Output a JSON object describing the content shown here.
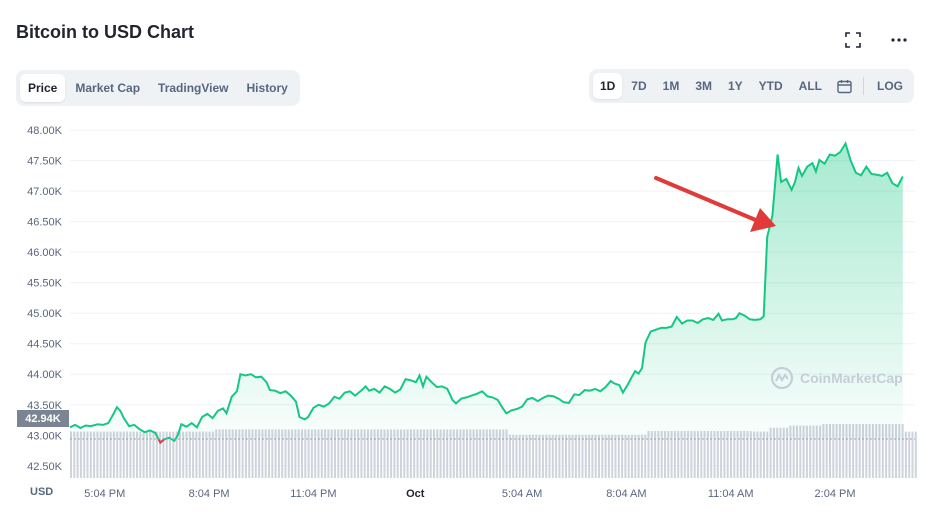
{
  "page": {
    "title": "Bitcoin to USD Chart",
    "tabs": [
      {
        "label": "Price",
        "active": true
      },
      {
        "label": "Market Cap",
        "active": false
      },
      {
        "label": "TradingView",
        "active": false
      },
      {
        "label": "History",
        "active": false
      }
    ],
    "ranges": [
      {
        "label": "1D",
        "active": true
      },
      {
        "label": "7D",
        "active": false
      },
      {
        "label": "1M",
        "active": false
      },
      {
        "label": "3M",
        "active": false
      },
      {
        "label": "1Y",
        "active": false
      },
      {
        "label": "YTD",
        "active": false
      },
      {
        "label": "ALL",
        "active": false
      }
    ],
    "log_label": "LOG",
    "currency_label": "USD",
    "current_price_label": "42.94K",
    "watermark": "CoinMarketCap",
    "icons": [
      "fullscreen-icon",
      "more-icon",
      "calendar-icon",
      "coinmarketcap-logo-icon"
    ]
  },
  "colors": {
    "line": "#16c784",
    "negative": "#ea3943",
    "area_top": "#16c784",
    "volume": "#cfd3dc",
    "annotation_arrow": "#e03a3a"
  },
  "chart_data": {
    "type": "area",
    "title": "",
    "xlabel": "",
    "ylabel": "",
    "ylim": [
      42300,
      48100
    ],
    "y_ticks": [
      "48.00K",
      "47.50K",
      "47.00K",
      "46.50K",
      "46.00K",
      "45.50K",
      "45.00K",
      "44.50K",
      "44.00K",
      "43.50K",
      "43.00K",
      "42.50K"
    ],
    "y_tick_values": [
      48000,
      47500,
      47000,
      46500,
      46000,
      45500,
      45000,
      44500,
      44000,
      43500,
      43000,
      42500
    ],
    "x_ticks": [
      {
        "label": "5:04 PM",
        "t": 1.0,
        "bold": false
      },
      {
        "label": "8:04 PM",
        "t": 4.0,
        "bold": false
      },
      {
        "label": "11:04 PM",
        "t": 7.0,
        "bold": false
      },
      {
        "label": "Oct",
        "t": 9.93,
        "bold": true
      },
      {
        "label": "5:04 AM",
        "t": 13.0,
        "bold": false
      },
      {
        "label": "8:04 AM",
        "t": 16.0,
        "bold": false
      },
      {
        "label": "11:04 AM",
        "t": 19.0,
        "bold": false
      },
      {
        "label": "2:04 PM",
        "t": 22.0,
        "bold": false
      }
    ],
    "x_range_hours": [
      0,
      24.3
    ],
    "series": [
      {
        "points": [
          [
            0.0,
            43130
          ],
          [
            0.15,
            43170
          ],
          [
            0.3,
            43120
          ],
          [
            0.45,
            43160
          ],
          [
            0.6,
            43150
          ],
          [
            0.8,
            43180
          ],
          [
            0.95,
            43170
          ],
          [
            1.1,
            43200
          ],
          [
            1.25,
            43350
          ],
          [
            1.35,
            43460
          ],
          [
            1.45,
            43400
          ],
          [
            1.55,
            43280
          ],
          [
            1.7,
            43150
          ],
          [
            1.85,
            43170
          ],
          [
            2.0,
            43100
          ],
          [
            2.15,
            43050
          ],
          [
            2.3,
            43080
          ],
          [
            2.45,
            43040
          ],
          [
            2.55,
            42930
          ],
          [
            2.6,
            42880
          ],
          [
            2.7,
            42930
          ],
          [
            2.85,
            42960
          ],
          [
            3.0,
            42910
          ],
          [
            3.1,
            43000
          ],
          [
            3.2,
            43180
          ],
          [
            3.35,
            43140
          ],
          [
            3.5,
            43200
          ],
          [
            3.65,
            43130
          ],
          [
            3.8,
            43300
          ],
          [
            3.95,
            43350
          ],
          [
            4.1,
            43280
          ],
          [
            4.25,
            43400
          ],
          [
            4.4,
            43440
          ],
          [
            4.5,
            43360
          ],
          [
            4.65,
            43630
          ],
          [
            4.8,
            43720
          ],
          [
            4.9,
            44000
          ],
          [
            5.05,
            43980
          ],
          [
            5.2,
            44000
          ],
          [
            5.35,
            43950
          ],
          [
            5.5,
            43960
          ],
          [
            5.65,
            43870
          ],
          [
            5.75,
            43740
          ],
          [
            5.9,
            43730
          ],
          [
            6.05,
            43690
          ],
          [
            6.2,
            43720
          ],
          [
            6.35,
            43650
          ],
          [
            6.5,
            43550
          ],
          [
            6.6,
            43300
          ],
          [
            6.75,
            43260
          ],
          [
            6.85,
            43300
          ],
          [
            7.0,
            43450
          ],
          [
            7.15,
            43500
          ],
          [
            7.3,
            43470
          ],
          [
            7.45,
            43520
          ],
          [
            7.6,
            43630
          ],
          [
            7.75,
            43600
          ],
          [
            7.9,
            43700
          ],
          [
            8.05,
            43720
          ],
          [
            8.2,
            43650
          ],
          [
            8.35,
            43720
          ],
          [
            8.5,
            43800
          ],
          [
            8.6,
            43730
          ],
          [
            8.75,
            43760
          ],
          [
            8.9,
            43700
          ],
          [
            9.05,
            43800
          ],
          [
            9.2,
            43760
          ],
          [
            9.35,
            43700
          ],
          [
            9.5,
            43750
          ],
          [
            9.65,
            43920
          ],
          [
            9.8,
            43900
          ],
          [
            9.95,
            43870
          ],
          [
            10.05,
            43980
          ],
          [
            10.15,
            43800
          ],
          [
            10.25,
            43960
          ],
          [
            10.4,
            43870
          ],
          [
            10.55,
            43790
          ],
          [
            10.7,
            43800
          ],
          [
            10.85,
            43760
          ],
          [
            11.0,
            43580
          ],
          [
            11.1,
            43520
          ],
          [
            11.25,
            43600
          ],
          [
            11.4,
            43620
          ],
          [
            11.55,
            43650
          ],
          [
            11.7,
            43680
          ],
          [
            11.85,
            43720
          ],
          [
            12.0,
            43640
          ],
          [
            12.15,
            43620
          ],
          [
            12.3,
            43580
          ],
          [
            12.45,
            43440
          ],
          [
            12.55,
            43360
          ],
          [
            12.7,
            43410
          ],
          [
            12.85,
            43430
          ],
          [
            13.0,
            43470
          ],
          [
            13.15,
            43590
          ],
          [
            13.3,
            43610
          ],
          [
            13.45,
            43560
          ],
          [
            13.6,
            43610
          ],
          [
            13.75,
            43650
          ],
          [
            13.9,
            43640
          ],
          [
            14.05,
            43600
          ],
          [
            14.2,
            43540
          ],
          [
            14.35,
            43530
          ],
          [
            14.5,
            43670
          ],
          [
            14.65,
            43660
          ],
          [
            14.8,
            43740
          ],
          [
            14.95,
            43730
          ],
          [
            15.1,
            43760
          ],
          [
            15.25,
            43720
          ],
          [
            15.4,
            43790
          ],
          [
            15.55,
            43890
          ],
          [
            15.65,
            43850
          ],
          [
            15.8,
            43820
          ],
          [
            15.9,
            43700
          ],
          [
            16.05,
            43840
          ],
          [
            16.15,
            43950
          ],
          [
            16.25,
            44050
          ],
          [
            16.35,
            44010
          ],
          [
            16.45,
            44100
          ],
          [
            16.55,
            44520
          ],
          [
            16.7,
            44700
          ],
          [
            16.85,
            44730
          ],
          [
            17.0,
            44760
          ],
          [
            17.15,
            44760
          ],
          [
            17.3,
            44780
          ],
          [
            17.45,
            44940
          ],
          [
            17.6,
            44830
          ],
          [
            17.75,
            44880
          ],
          [
            17.9,
            44880
          ],
          [
            18.05,
            44840
          ],
          [
            18.2,
            44900
          ],
          [
            18.35,
            44920
          ],
          [
            18.5,
            44890
          ],
          [
            18.65,
            44990
          ],
          [
            18.75,
            44880
          ],
          [
            18.9,
            44900
          ],
          [
            19.05,
            44900
          ],
          [
            19.15,
            44920
          ],
          [
            19.25,
            45000
          ],
          [
            19.4,
            44960
          ],
          [
            19.55,
            44900
          ],
          [
            19.7,
            44890
          ],
          [
            19.85,
            44900
          ],
          [
            19.95,
            44950
          ],
          [
            20.05,
            46250
          ],
          [
            20.2,
            46600
          ],
          [
            20.35,
            47600
          ],
          [
            20.45,
            47150
          ],
          [
            20.6,
            47200
          ],
          [
            20.75,
            47020
          ],
          [
            20.85,
            47150
          ],
          [
            20.95,
            47380
          ],
          [
            21.05,
            47250
          ],
          [
            21.2,
            47400
          ],
          [
            21.35,
            47460
          ],
          [
            21.45,
            47320
          ],
          [
            21.55,
            47510
          ],
          [
            21.7,
            47450
          ],
          [
            21.85,
            47600
          ],
          [
            22.0,
            47580
          ],
          [
            22.15,
            47640
          ],
          [
            22.3,
            47780
          ],
          [
            22.45,
            47500
          ],
          [
            22.6,
            47300
          ],
          [
            22.75,
            47260
          ],
          [
            22.9,
            47400
          ],
          [
            23.05,
            47280
          ],
          [
            23.2,
            47270
          ],
          [
            23.35,
            47250
          ],
          [
            23.5,
            47300
          ],
          [
            23.65,
            47130
          ],
          [
            23.8,
            47080
          ],
          [
            23.95,
            47240
          ]
        ]
      }
    ],
    "volume_levels": [
      {
        "from": 0.0,
        "to": 4.1,
        "level": 0.86
      },
      {
        "from": 4.1,
        "to": 12.6,
        "level": 0.9
      },
      {
        "from": 12.6,
        "to": 16.6,
        "level": 0.8
      },
      {
        "from": 16.6,
        "to": 19.6,
        "level": 0.87
      },
      {
        "from": 19.6,
        "to": 20.1,
        "level": 0.86
      },
      {
        "from": 20.1,
        "to": 20.6,
        "level": 0.93
      },
      {
        "from": 20.6,
        "to": 21.6,
        "level": 0.97
      },
      {
        "from": 21.6,
        "to": 24.0,
        "level": 1.0
      }
    ],
    "grid": true,
    "legend": "none"
  }
}
